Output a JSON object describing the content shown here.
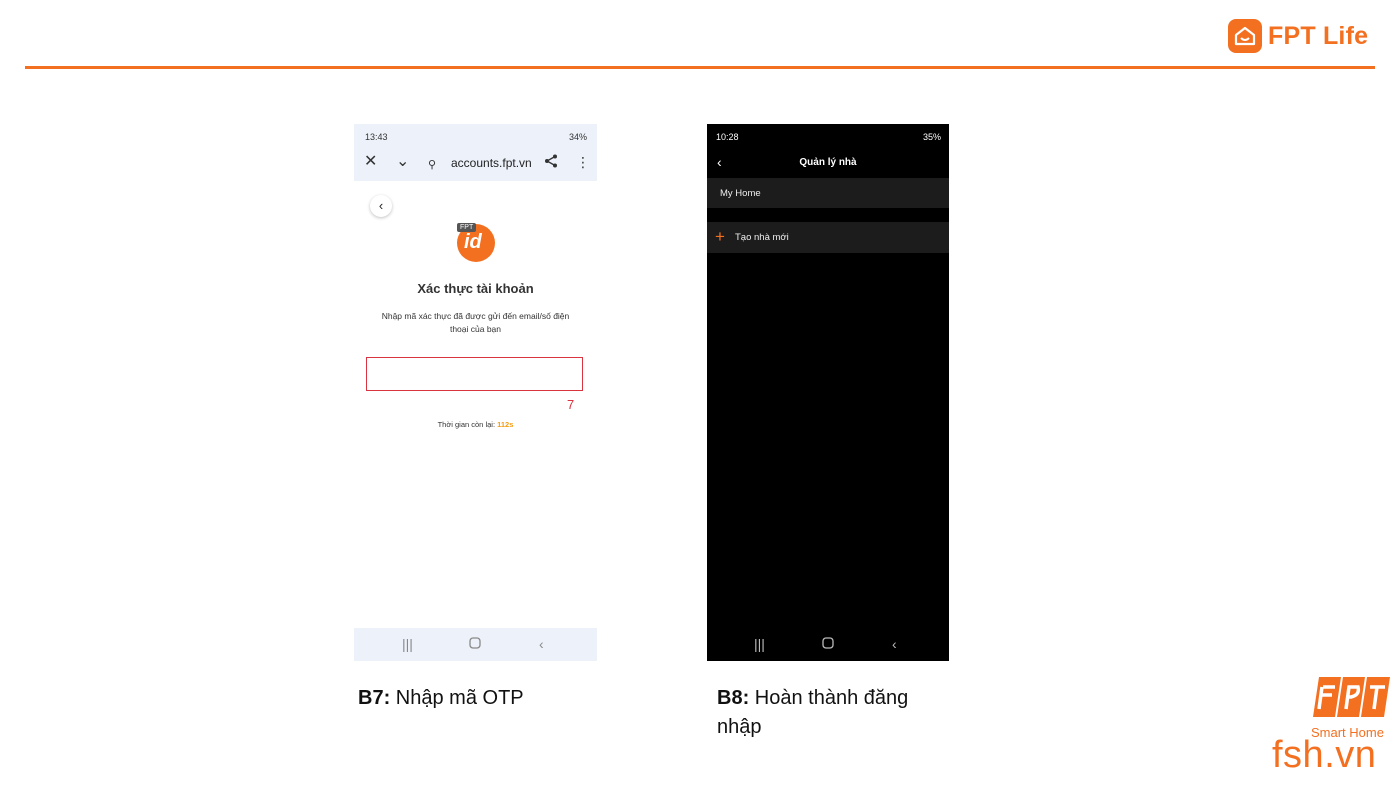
{
  "header": {
    "brand_name": "FPT Life",
    "accent_color": "#f37021"
  },
  "phone1": {
    "status": {
      "time": "13:43",
      "right": "34%"
    },
    "browser": {
      "url": "accounts.fpt.vn"
    },
    "logo": {
      "tag": "FPT",
      "mark": "id"
    },
    "title": "Xác thực tài khoản",
    "subtitle": "Nhập mã xác thực đã được gửi đến email/số điện thoại của bạn",
    "otp": {
      "value": "",
      "counter": "7"
    },
    "timer": {
      "label": "Thời gian còn lại:",
      "value": "112s"
    }
  },
  "phone2": {
    "status": {
      "time": "10:28",
      "right": "35%"
    },
    "title": "Quản lý nhà",
    "items": [
      {
        "label": "My Home"
      },
      {
        "label": "Tạo nhà mới"
      }
    ]
  },
  "captions": [
    {
      "step": "B7:",
      "text": "Nhập mã OTP"
    },
    {
      "step": "B8:",
      "text": "Hoàn thành đăng nhập"
    }
  ],
  "footer": {
    "smart_home": "Smart Home",
    "site": "fsh.vn"
  }
}
